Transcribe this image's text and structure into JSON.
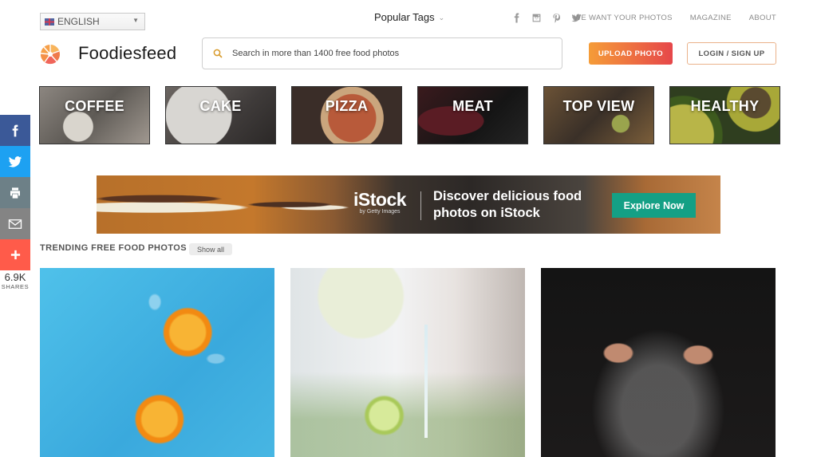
{
  "top_bar": {
    "language": "ENGLISH",
    "popular_tags": "Popular Tags",
    "social_icons": [
      "facebook-icon",
      "instagram-icon",
      "pinterest-icon",
      "twitter-icon"
    ],
    "links": [
      "WE WANT YOUR PHOTOS",
      "MAGAZINE",
      "ABOUT"
    ]
  },
  "header": {
    "brand": "Foodiesfeed",
    "search_placeholder": "Search in more than 1400 free food photos",
    "search_value": "",
    "upload_label": "UPLOAD PHOTO",
    "login_label": "LOGIN / SIGN UP"
  },
  "categories": [
    {
      "label": "COFFEE"
    },
    {
      "label": "CAKE"
    },
    {
      "label": "PIZZA"
    },
    {
      "label": "MEAT"
    },
    {
      "label": "TOP VIEW"
    },
    {
      "label": "HEALTHY"
    }
  ],
  "share_bar": {
    "buttons": [
      "facebook",
      "twitter",
      "print",
      "email",
      "more"
    ],
    "count": "6.9K",
    "count_label": "SHARES"
  },
  "ad": {
    "brand": "iStock",
    "brand_sub": "by Getty Images",
    "headline": "Discover delicious food photos on iStock",
    "cta": "Explore Now"
  },
  "trending": {
    "title": "TRENDING FREE FOOD PHOTOS",
    "show_all": "Show all",
    "photos": [
      {
        "subject": "orange halves with ice on blue"
      },
      {
        "subject": "water pouring into glass with lime"
      },
      {
        "subject": "hands clapping flour on dark background"
      }
    ]
  },
  "colors": {
    "upload_gradient": [
      "#f59c38",
      "#e6474a"
    ],
    "ad_cta": "#14a085",
    "facebook": "#3b5998",
    "twitter": "#1da1f2",
    "print": "#6d8087",
    "email": "#848484",
    "more": "#ff5b4a"
  }
}
